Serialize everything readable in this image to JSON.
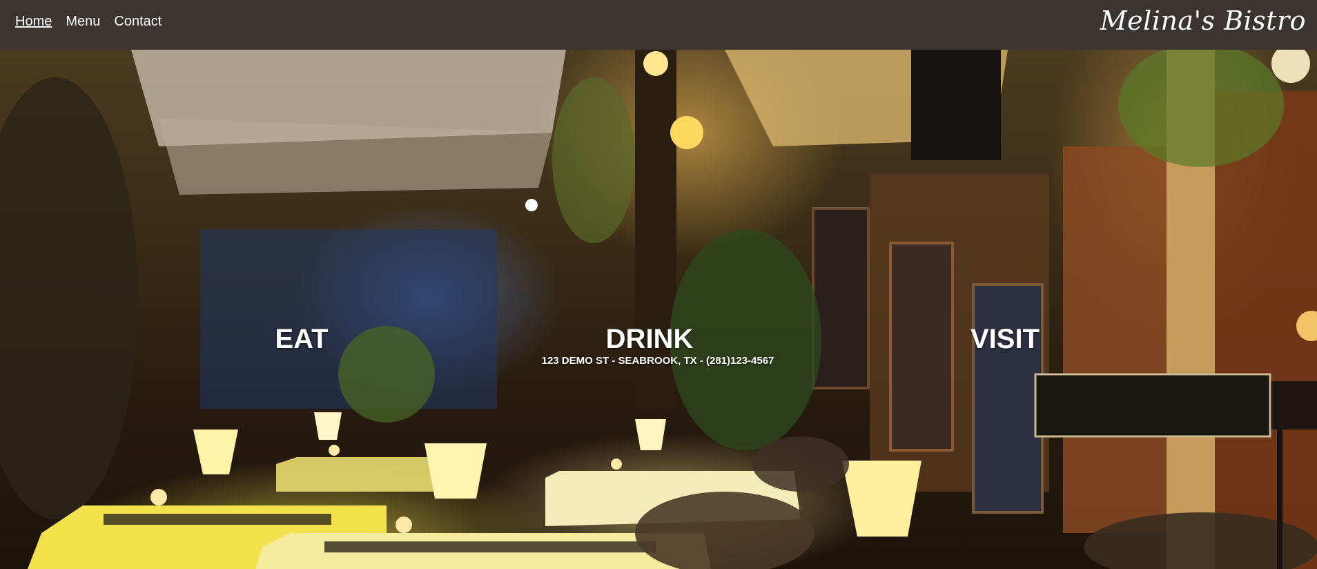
{
  "nav": {
    "links": [
      {
        "label": "Home",
        "active": true
      },
      {
        "label": "Menu",
        "active": false
      },
      {
        "label": "Contact",
        "active": false
      }
    ],
    "brand": "Melina's Bistro"
  },
  "hero": {
    "headings": [
      "EAT",
      "DRINK",
      "VISIT"
    ],
    "address": "123 DEMO ST - SEABROOK, TX - (281)123-4567"
  },
  "colors": {
    "navbar_bg": "#3b3532",
    "text": "#ffffff"
  }
}
